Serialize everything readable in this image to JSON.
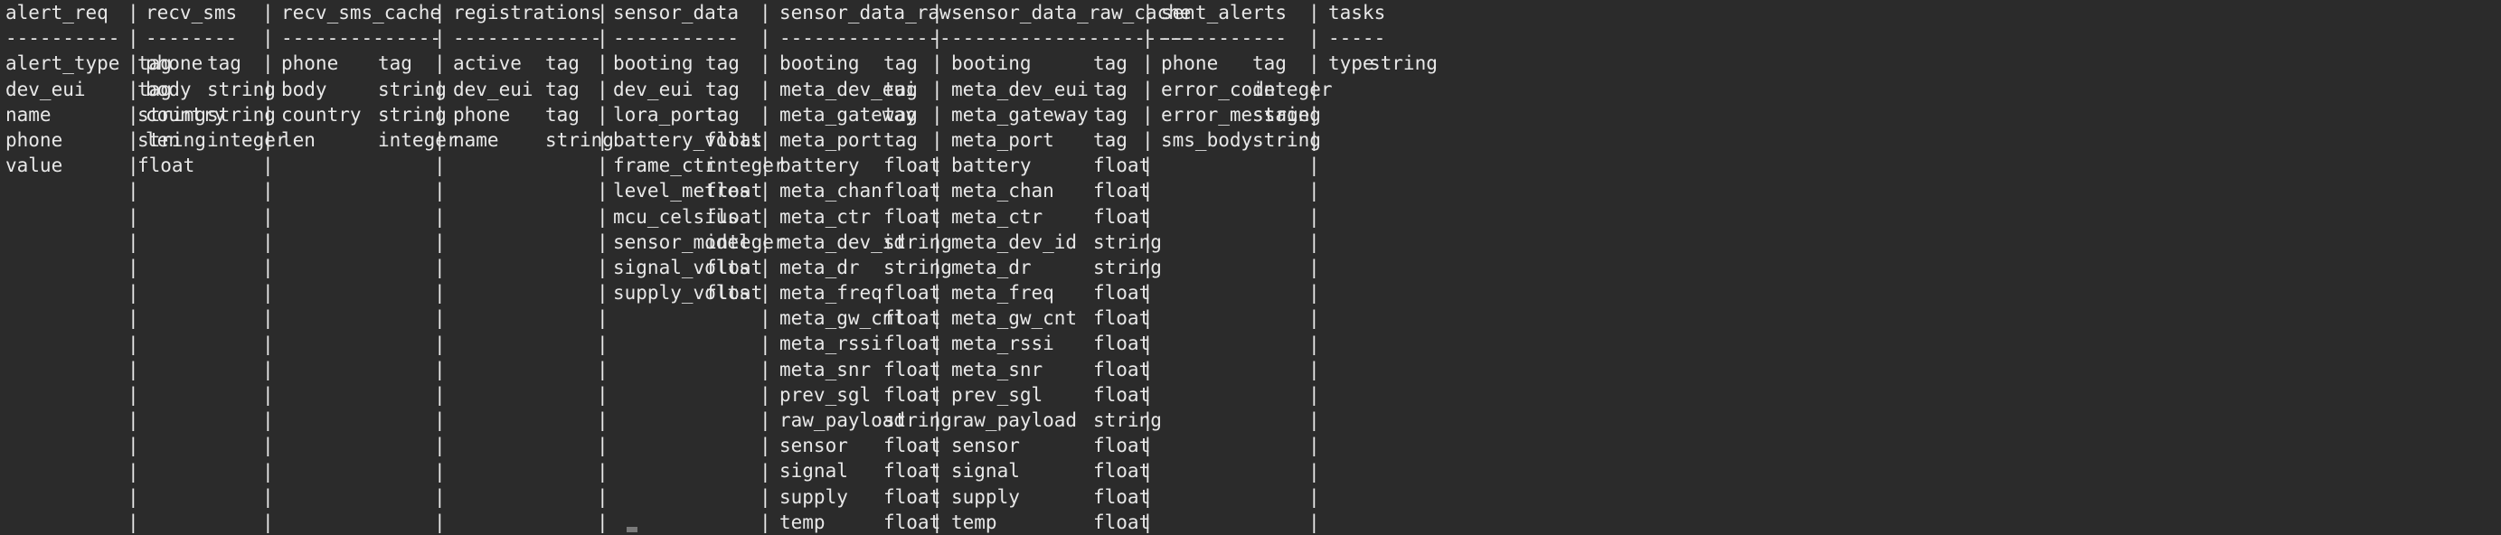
{
  "terminal": {
    "measurements": [
      {
        "name": "alert_req",
        "underline": "----------",
        "fields": [
          [
            "alert_type",
            "tag"
          ],
          [
            "dev_eui",
            "tag"
          ],
          [
            "name",
            "string"
          ],
          [
            "phone",
            "string"
          ],
          [
            "value",
            "float"
          ]
        ]
      },
      {
        "name": "recv_sms",
        "underline": "--------",
        "fields": [
          [
            "phone",
            "tag"
          ],
          [
            "body",
            "string"
          ],
          [
            "country",
            "string"
          ],
          [
            "len",
            "integer"
          ]
        ]
      },
      {
        "name": "recv_sms_cache",
        "underline": "--------------",
        "fields": [
          [
            "phone",
            "tag"
          ],
          [
            "body",
            "string"
          ],
          [
            "country",
            "string"
          ],
          [
            "len",
            "integer"
          ]
        ]
      },
      {
        "name": "registrations",
        "underline": "-------------",
        "fields": [
          [
            "active",
            "tag"
          ],
          [
            "dev_eui",
            "tag"
          ],
          [
            "phone",
            "tag"
          ],
          [
            "name",
            "string"
          ]
        ]
      },
      {
        "name": "sensor_data",
        "underline": "-----------",
        "fields": [
          [
            "booting",
            "tag"
          ],
          [
            "dev_eui",
            "tag"
          ],
          [
            "lora_port",
            "tag"
          ],
          [
            "battery_volts",
            "float"
          ],
          [
            "frame_ctr",
            "integer"
          ],
          [
            "level_metres",
            "float"
          ],
          [
            "mcu_celsius",
            "float"
          ],
          [
            "sensor_model",
            "integer"
          ],
          [
            "signal_volts",
            "float"
          ],
          [
            "supply_volts",
            "float"
          ]
        ]
      },
      {
        "name": "sensor_data_raw",
        "underline": "---------------",
        "fields": [
          [
            "booting",
            "tag"
          ],
          [
            "meta_dev_eui",
            "tag"
          ],
          [
            "meta_gateway",
            "tag"
          ],
          [
            "meta_port",
            "tag"
          ],
          [
            "battery",
            "float"
          ],
          [
            "meta_chan",
            "float"
          ],
          [
            "meta_ctr",
            "float"
          ],
          [
            "meta_dev_id",
            "string"
          ],
          [
            "meta_dr",
            "string"
          ],
          [
            "meta_freq",
            "float"
          ],
          [
            "meta_gw_cnt",
            "float"
          ],
          [
            "meta_rssi",
            "float"
          ],
          [
            "meta_snr",
            "float"
          ],
          [
            "prev_sgl",
            "float"
          ],
          [
            "raw_payload",
            "string"
          ],
          [
            "sensor",
            "float"
          ],
          [
            "signal",
            "float"
          ],
          [
            "supply",
            "float"
          ],
          [
            "temp",
            "float"
          ]
        ]
      },
      {
        "name": "sensor_data_raw_cache",
        "underline": "---------------------",
        "fields": [
          [
            "booting",
            "tag"
          ],
          [
            "meta_dev_eui",
            "tag"
          ],
          [
            "meta_gateway",
            "tag"
          ],
          [
            "meta_port",
            "tag"
          ],
          [
            "battery",
            "float"
          ],
          [
            "meta_chan",
            "float"
          ],
          [
            "meta_ctr",
            "float"
          ],
          [
            "meta_dev_id",
            "string"
          ],
          [
            "meta_dr",
            "string"
          ],
          [
            "meta_freq",
            "float"
          ],
          [
            "meta_gw_cnt",
            "float"
          ],
          [
            "meta_rssi",
            "float"
          ],
          [
            "meta_snr",
            "float"
          ],
          [
            "prev_sgl",
            "float"
          ],
          [
            "raw_payload",
            "string"
          ],
          [
            "sensor",
            "float"
          ],
          [
            "signal",
            "float"
          ],
          [
            "supply",
            "float"
          ],
          [
            "temp",
            "float"
          ]
        ]
      },
      {
        "name": "sent_alerts",
        "underline": "-----------",
        "fields": [
          [
            "phone",
            "tag"
          ],
          [
            "error_code",
            "integer"
          ],
          [
            "error_message",
            "string"
          ],
          [
            "sms_body",
            "string"
          ]
        ]
      },
      {
        "name": "tasks",
        "underline": "-----",
        "fields": [
          [
            "type",
            "string"
          ]
        ]
      }
    ],
    "separator_char": "|"
  }
}
